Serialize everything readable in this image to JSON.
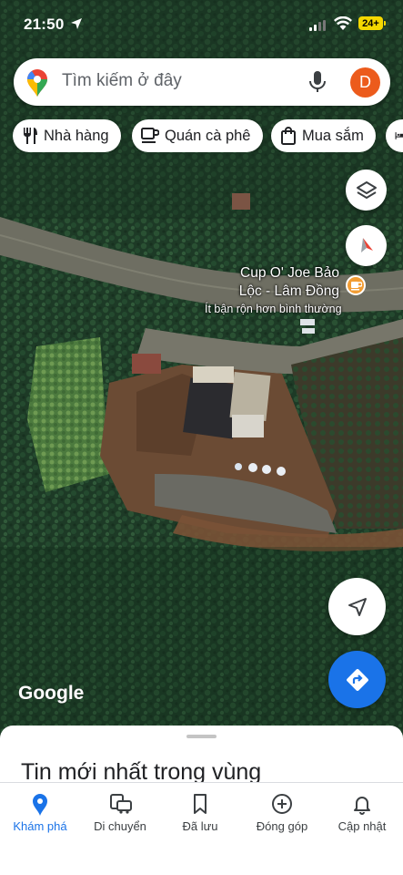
{
  "status_bar": {
    "time": "21:50",
    "battery": "24+"
  },
  "search": {
    "placeholder": "Tìm kiếm ở đây",
    "avatar_letter": "D"
  },
  "chips": [
    {
      "label": "Nhà hàng",
      "icon": "fork-knife-icon"
    },
    {
      "label": "Quán cà phê",
      "icon": "coffee-cup-icon"
    },
    {
      "label": "Mua sắm",
      "icon": "shopping-bag-icon"
    },
    {
      "label": "",
      "icon": "hotel-bed-icon"
    }
  ],
  "place": {
    "name_line1": "Cup O' Joe Bảo",
    "name_line2": "Lộc - Lâm Đồng",
    "busyness": "Ít bận rộn hơn bình thường",
    "marker_icon": "coffee-cup-icon",
    "marker_color": "#f29d34"
  },
  "map": {
    "attribution": "Google",
    "type": "satellite"
  },
  "buttons": {
    "layers_icon": "layers-icon",
    "compass_icon": "compass-icon",
    "my_location_icon": "navigation-arrow-icon",
    "directions_icon": "directions-icon",
    "directions_color": "#1a73e8"
  },
  "sheet": {
    "title": "Tin mới nhất trong vùng"
  },
  "bottom_nav": [
    {
      "label": "Khám phá",
      "icon": "explore-pin-icon",
      "active": true
    },
    {
      "label": "Di chuyển",
      "icon": "commute-icon",
      "active": false
    },
    {
      "label": "Đã lưu",
      "icon": "bookmark-icon",
      "active": false
    },
    {
      "label": "Đóng góp",
      "icon": "add-circle-icon",
      "active": false
    },
    {
      "label": "Cập nhật",
      "icon": "bell-icon",
      "active": false
    }
  ],
  "colors": {
    "accent": "#1a73e8",
    "avatar": "#ec5b1c"
  }
}
